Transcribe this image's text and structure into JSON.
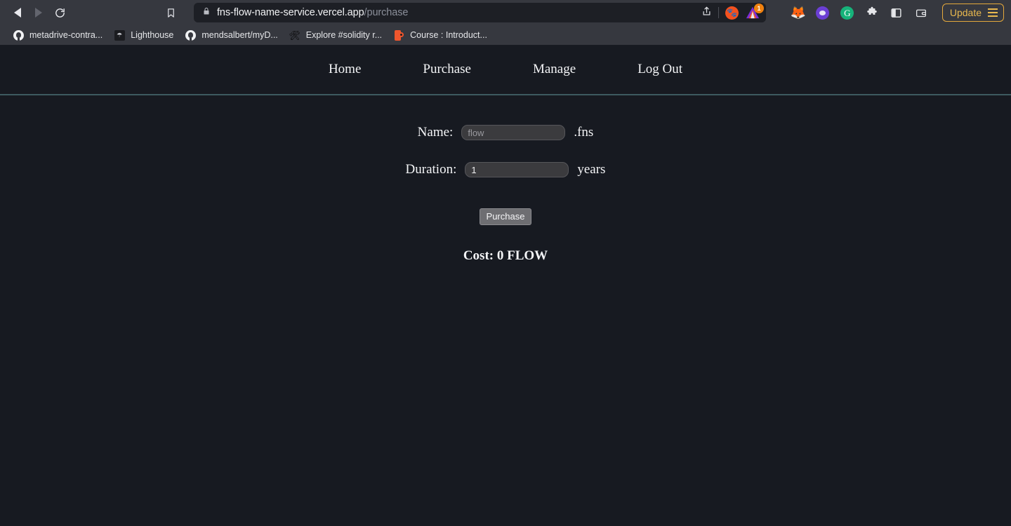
{
  "browser": {
    "back_icon": "back-arrow-icon",
    "forward_icon": "forward-arrow-icon",
    "reload_icon": "reload-icon",
    "bookmark_icon": "bookmark-flag-icon",
    "address": {
      "lock_icon": "lock-icon",
      "domain": "fns-flow-name-service.vercel.app",
      "path": "/purchase",
      "share_icon": "share-icon",
      "shield_icon": "brave-shields-icon",
      "leo_icon": "brave-leo-icon",
      "leo_badge": "1"
    },
    "extensions": [
      {
        "name": "metamask-icon",
        "glyph": "🦊"
      },
      {
        "name": "wallet-extension-icon",
        "glyph": ""
      },
      {
        "name": "grammarly-icon",
        "glyph": "G"
      },
      {
        "name": "extensions-puzzle-icon",
        "glyph": "🧩"
      },
      {
        "name": "sidebar-toggle-icon",
        "glyph": ""
      },
      {
        "name": "brave-wallet-icon",
        "glyph": ""
      }
    ],
    "update_button": {
      "label": "Update",
      "menu_icon": "hamburger-menu-icon",
      "accent": "#e9b94f"
    },
    "bookmarks": [
      {
        "icon": "github-icon",
        "label": "metadrive-contra..."
      },
      {
        "icon": "lighthouse-icon",
        "label": "Lighthouse"
      },
      {
        "icon": "github-icon",
        "label": "mendsalbert/myD..."
      },
      {
        "icon": "hammer-wrench-icon",
        "label": "Explore #solidity r..."
      },
      {
        "icon": "course-icon",
        "label": "Course : Introduct..."
      }
    ]
  },
  "site": {
    "nav": [
      {
        "label": "Home",
        "name": "nav-link-home"
      },
      {
        "label": "Purchase",
        "name": "nav-link-purchase"
      },
      {
        "label": "Manage",
        "name": "nav-link-manage"
      },
      {
        "label": "Log Out",
        "name": "nav-link-logout"
      }
    ],
    "form": {
      "name_label": "Name:",
      "name_placeholder": "flow",
      "name_value": "",
      "name_suffix": ".fns",
      "duration_label": "Duration:",
      "duration_value": "1",
      "duration_placeholder": "",
      "duration_suffix": "years",
      "purchase_button": "Purchase"
    },
    "cost_text": "Cost: 0 FLOW",
    "colors": {
      "page_bg": "#171a21",
      "divider": "#3d5a60",
      "input_bg": "#3b3b3e",
      "text": "#f4f5f7"
    }
  }
}
